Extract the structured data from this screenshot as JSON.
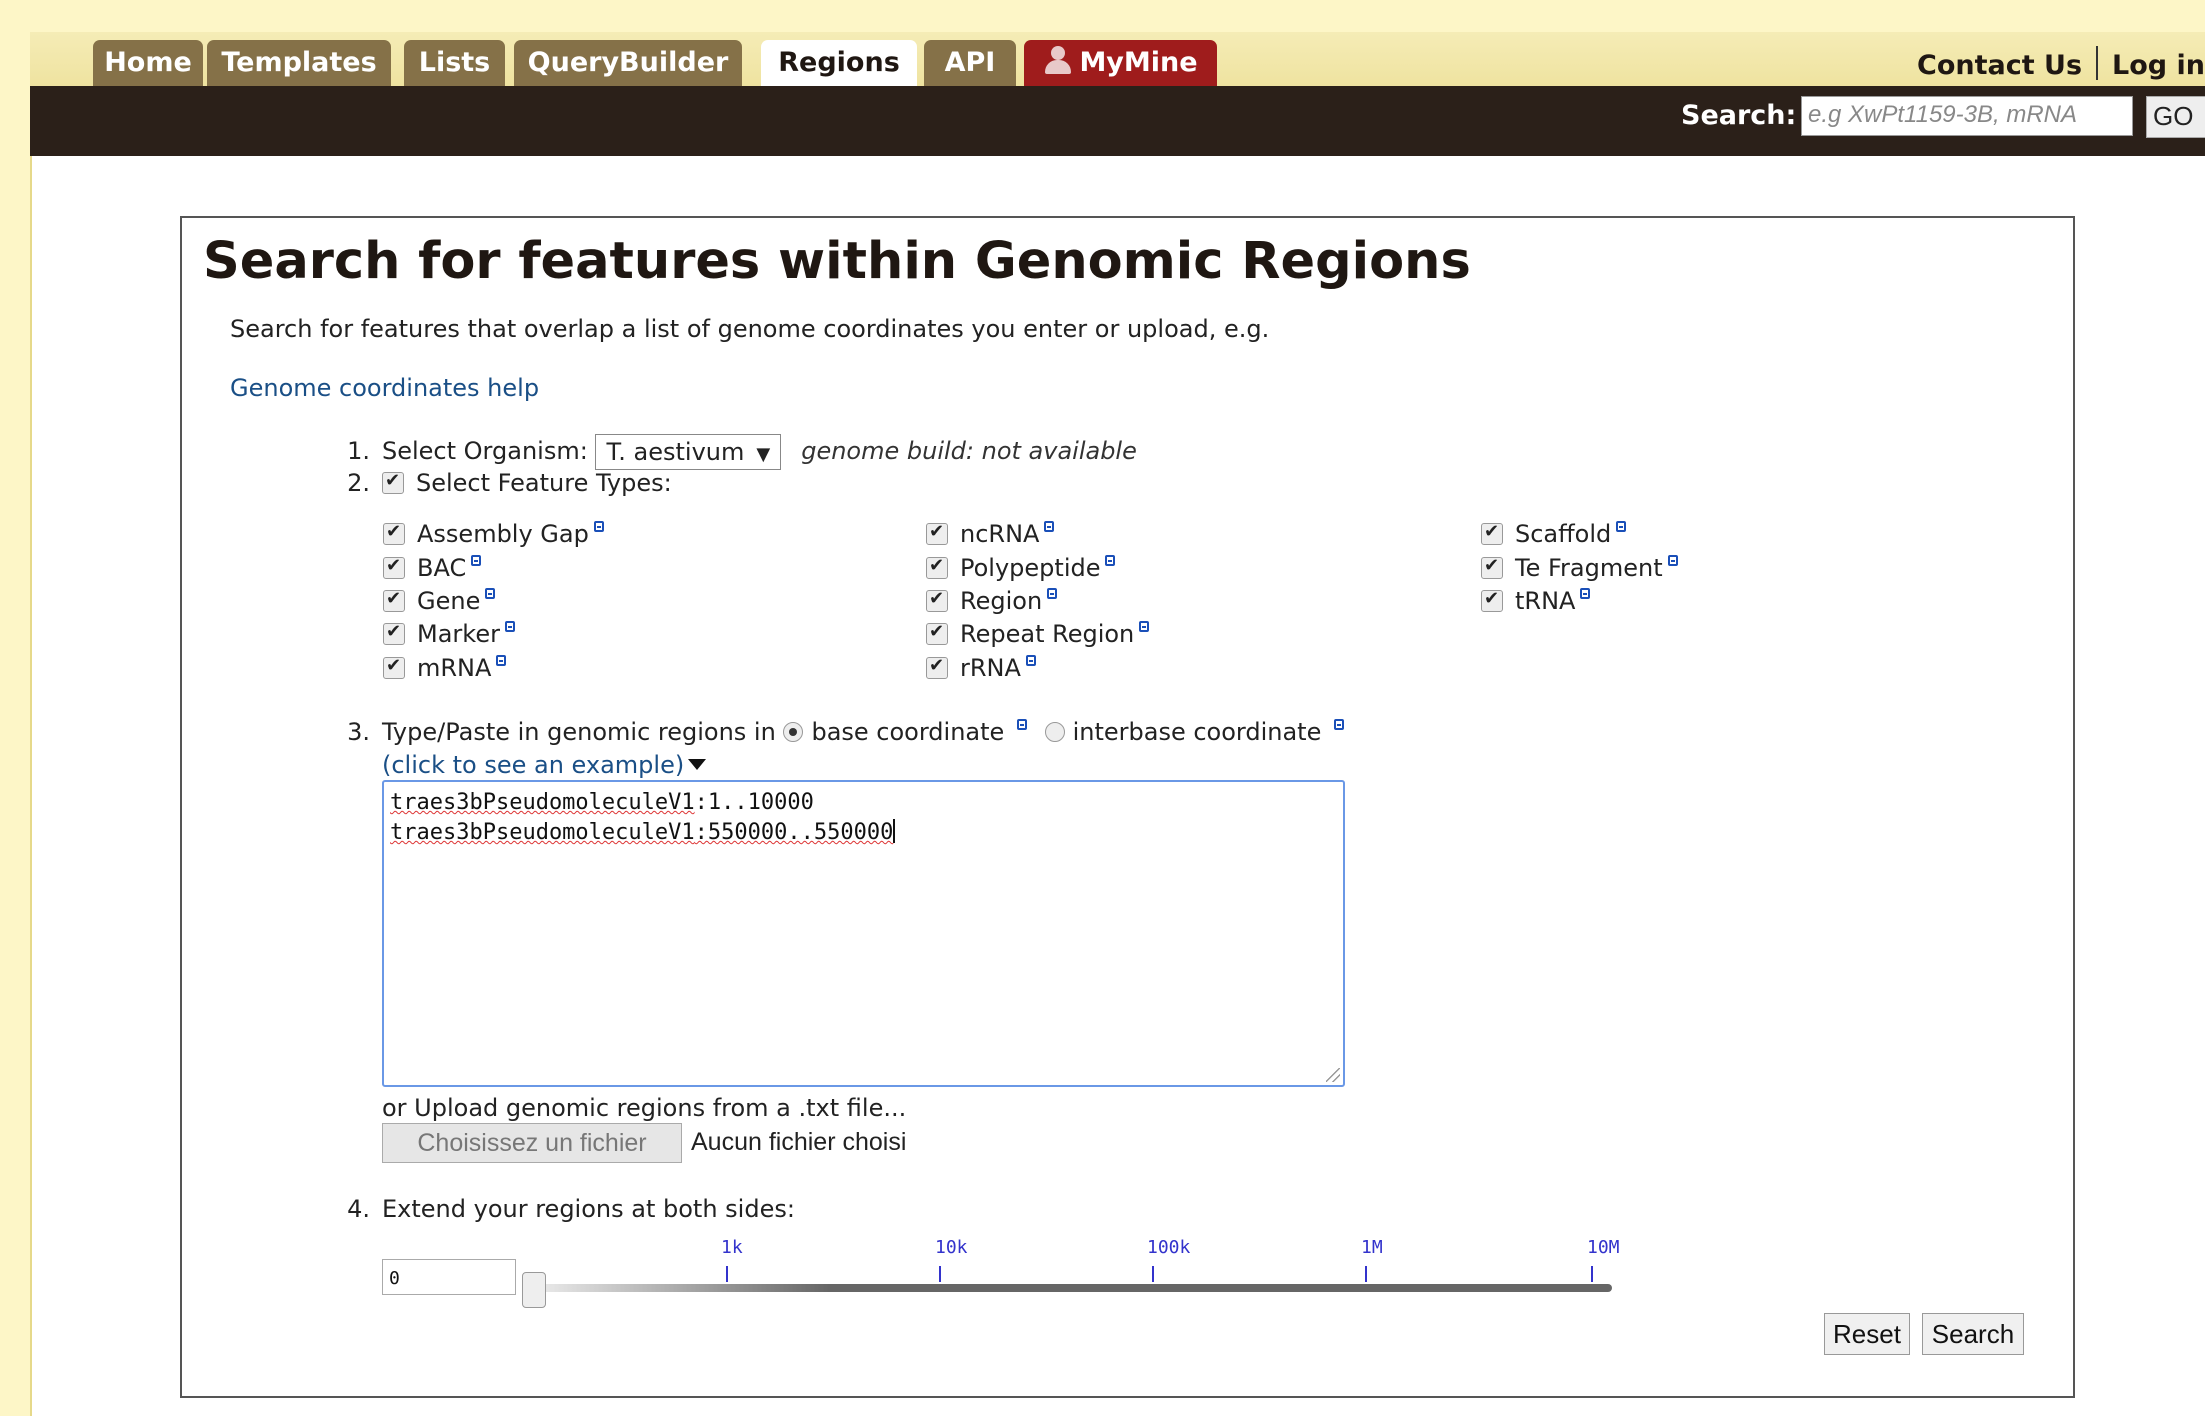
{
  "nav": {
    "tabs": [
      {
        "label": "Home",
        "active": false
      },
      {
        "label": "Templates",
        "active": false
      },
      {
        "label": "Lists",
        "active": false
      },
      {
        "label": "QueryBuilder",
        "active": false
      },
      {
        "label": "Regions",
        "active": true
      },
      {
        "label": "API",
        "active": false
      },
      {
        "label": "MyMine",
        "active": false,
        "icon": "person-icon"
      }
    ],
    "contact_label": "Contact Us",
    "login_label": "Log in"
  },
  "search": {
    "label": "Search:",
    "placeholder": "e.g XwPt1159-3B, mRNA",
    "go_label": "GO"
  },
  "page": {
    "title": "Search for features within Genomic Regions",
    "intro": "Search for features that overlap a list of genome coordinates you enter or upload, e.g.",
    "help_link": "Genome coordinates help"
  },
  "step1": {
    "num": "1.",
    "label": "Select Organism:",
    "organism": "T. aestivum",
    "genome_build": "genome build: not available"
  },
  "step2": {
    "num": "2.",
    "label": "Select Feature Types:",
    "all_checked": true,
    "features": [
      {
        "label": "Assembly Gap",
        "checked": true
      },
      {
        "label": "BAC",
        "checked": true
      },
      {
        "label": "Gene",
        "checked": true
      },
      {
        "label": "Marker",
        "checked": true
      },
      {
        "label": "mRNA",
        "checked": true
      },
      {
        "label": "ncRNA",
        "checked": true
      },
      {
        "label": "Polypeptide",
        "checked": true
      },
      {
        "label": "Region",
        "checked": true
      },
      {
        "label": "Repeat Region",
        "checked": true
      },
      {
        "label": "rRNA",
        "checked": true
      },
      {
        "label": "Scaffold",
        "checked": true
      },
      {
        "label": "Te Fragment",
        "checked": true
      },
      {
        "label": "tRNA",
        "checked": true
      }
    ]
  },
  "step3": {
    "num": "3.",
    "label": "Type/Paste in genomic regions in",
    "base_label": "base coordinate",
    "interbase_label": "interbase coordinate",
    "selected": "base coordinate",
    "example_link": "(click to see an example)",
    "regions": [
      {
        "seq": "traes3bPseudomoleculeV1",
        "range": ":1..10000"
      },
      {
        "seq": "traes3bPseudomoleculeV1",
        "range": ":550000..550000"
      }
    ],
    "upload_text": "or Upload genomic regions from a .txt file...",
    "file_button": "Choisissez un fichier",
    "file_status": "Aucun fichier choisi"
  },
  "step4": {
    "num": "4.",
    "label": "Extend your regions at both sides:",
    "value": "0",
    "slider_value": 0,
    "ticks": [
      "1k",
      "10k",
      "100k",
      "1M",
      "10M"
    ]
  },
  "actions": {
    "reset": "Reset",
    "search": "Search"
  }
}
